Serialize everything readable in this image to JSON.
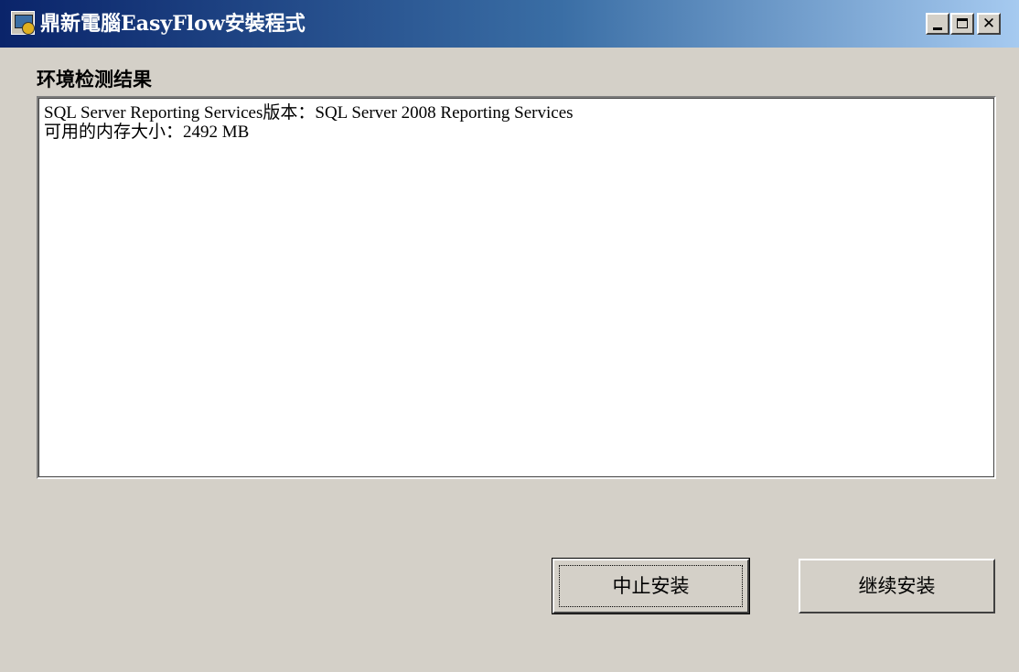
{
  "window": {
    "title": "鼎新電腦EasyFlow安裝程式",
    "controls": {
      "minimize_icon": "minimize-icon",
      "maximize_icon": "maximize-icon",
      "close_glyph": "✕"
    }
  },
  "main": {
    "section_label": "环境检测结果",
    "results": [
      "SQL Server Reporting Services版本：SQL Server 2008 Reporting Services",
      "可用的内存大小：2492 MB"
    ]
  },
  "buttons": {
    "abort_label": "中止安装",
    "continue_label": "继续安装"
  },
  "colors": {
    "window_bg": "#d4d0c8",
    "titlebar_start": "#0a246a",
    "titlebar_end": "#a6caf0"
  }
}
